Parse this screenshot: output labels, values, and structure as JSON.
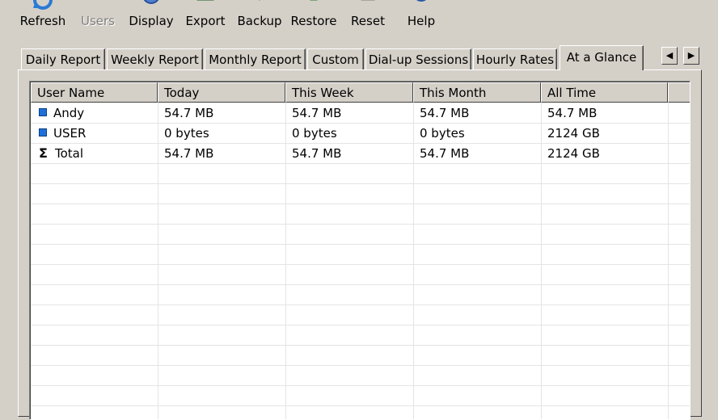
{
  "toolbar": {
    "buttons": [
      {
        "label": "Refresh",
        "icon": "refresh-icon",
        "disabled": false
      },
      {
        "label": "Users",
        "icon": "users-icon",
        "disabled": true
      },
      {
        "label": "Display",
        "icon": "display-icon",
        "disabled": false
      },
      {
        "label": "Export",
        "icon": "export-icon",
        "disabled": false
      },
      {
        "label": "Backup",
        "icon": "backup-icon",
        "disabled": false
      },
      {
        "label": "Restore",
        "icon": "restore-icon",
        "disabled": false
      },
      {
        "label": "Reset",
        "icon": "reset-icon",
        "disabled": false
      },
      {
        "label": "Help",
        "icon": "help-icon",
        "disabled": false
      }
    ]
  },
  "tabs": [
    {
      "label": "Daily Report"
    },
    {
      "label": "Weekly Report"
    },
    {
      "label": "Monthly Report"
    },
    {
      "label": "Custom"
    },
    {
      "label": "Dial-up Sessions"
    },
    {
      "label": "Hourly Rates"
    },
    {
      "label": "At a Glance",
      "active": true
    }
  ],
  "tab_scroll": {
    "left": "◀",
    "right": "▶"
  },
  "table": {
    "columns": [
      "User Name",
      "Today",
      "This Week",
      "This Month",
      "All Time"
    ],
    "rows": [
      {
        "icon": "user-square-icon",
        "cells": [
          "Andy",
          "54.7 MB",
          "54.7 MB",
          "54.7 MB",
          "54.7 MB"
        ]
      },
      {
        "icon": "user-square-icon",
        "cells": [
          "USER",
          "0 bytes",
          "0 bytes",
          "0 bytes",
          "2124 GB"
        ]
      },
      {
        "icon": "sigma-icon",
        "icon_glyph": "Σ",
        "cells": [
          "Total",
          "54.7 MB",
          "54.7 MB",
          "54.7 MB",
          "2124 GB"
        ]
      }
    ]
  },
  "colors": {
    "window_bg": "#d4d0c8",
    "list_bg": "#ffffff",
    "user_icon": "#1e6fd9"
  }
}
